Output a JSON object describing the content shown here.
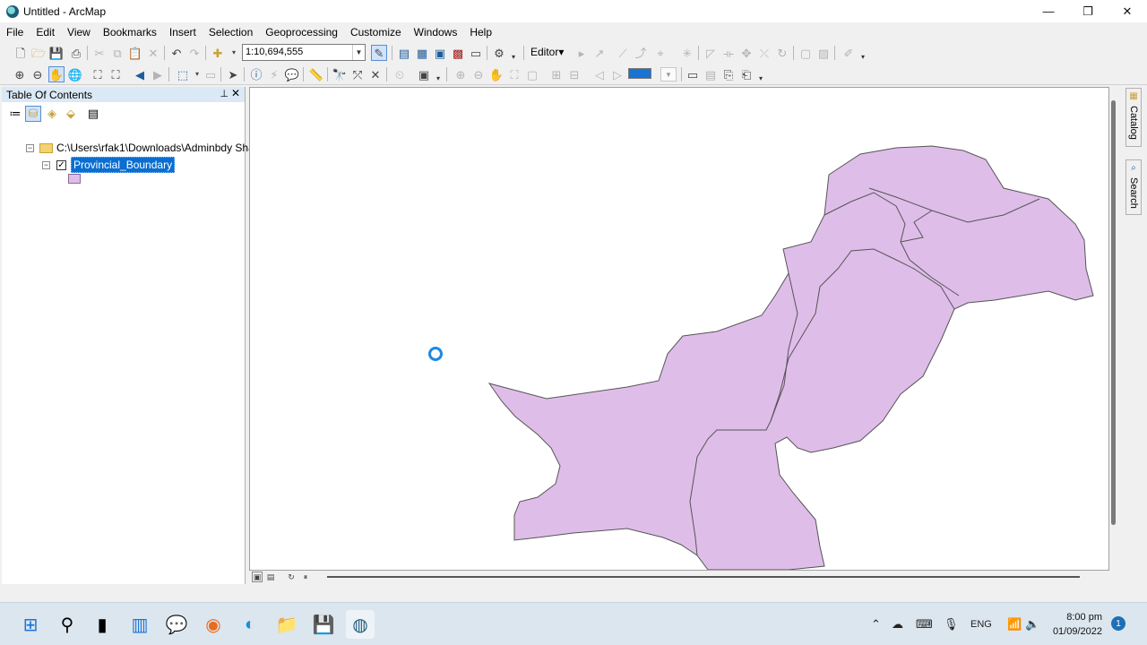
{
  "window": {
    "title": "Untitled - ArcMap"
  },
  "menu": [
    "File",
    "Edit",
    "View",
    "Bookmarks",
    "Insert",
    "Selection",
    "Geoprocessing",
    "Customize",
    "Windows",
    "Help"
  ],
  "toolbar": {
    "scale_value": "1:10,694,555",
    "editor_label": "Editor",
    "editor_caret": "▾",
    "highlight_color": "#1873d3"
  },
  "toc": {
    "title": "Table Of Contents",
    "data_source_path": "C:\\Users\\rfak1\\Downloads\\Adminbdy Sha",
    "layer_name": "Provincial_Boundary",
    "layer_fill_color": "#dfbde9"
  },
  "side_panels": [
    "Catalog",
    "Search"
  ],
  "taskbar": {
    "language": "ENG",
    "time": "8:00 pm",
    "date": "01/09/2022",
    "notifications": "1"
  }
}
